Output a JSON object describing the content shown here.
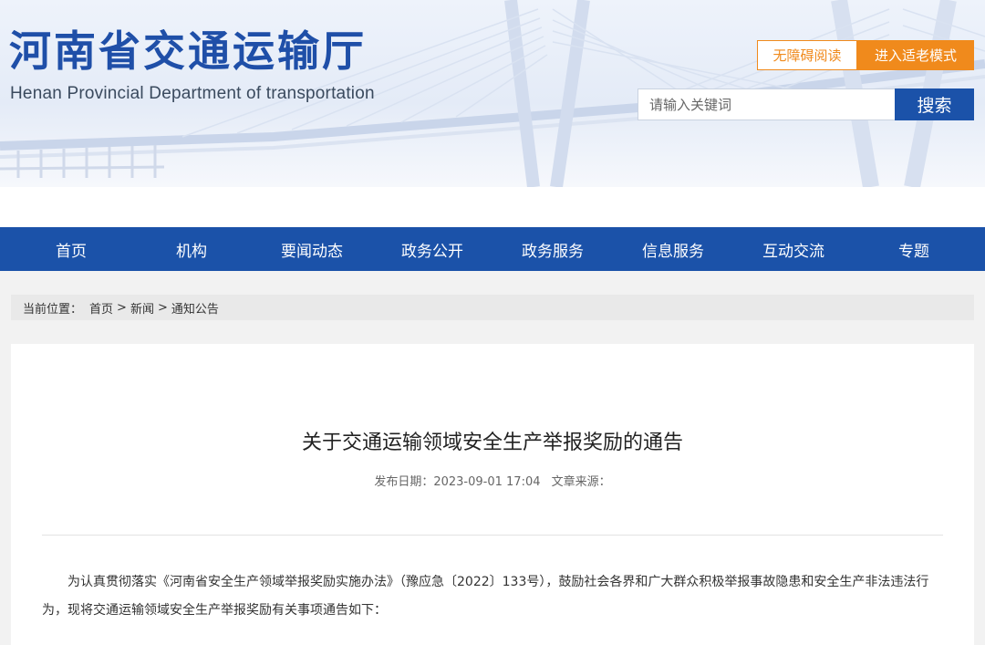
{
  "header": {
    "site_title": "河南省交通运输厅",
    "site_subtitle": "Henan Provincial Department of transportation",
    "accessible_label": "无障碍阅读",
    "elder_mode_label": "进入适老模式",
    "search": {
      "placeholder": "请输入关键词",
      "button_label": "搜索"
    }
  },
  "nav": {
    "items": [
      {
        "label": "首页"
      },
      {
        "label": "机构"
      },
      {
        "label": "要闻动态"
      },
      {
        "label": "政务公开"
      },
      {
        "label": "政务服务"
      },
      {
        "label": "信息服务"
      },
      {
        "label": "互动交流"
      },
      {
        "label": "专题"
      }
    ]
  },
  "breadcrumb": {
    "label": "当前位置：",
    "items": [
      "首页",
      "新闻",
      "通知公告"
    ],
    "separator": ">"
  },
  "article": {
    "title": "关于交通运输领域安全生产举报奖励的通告",
    "publish_date": "发布日期：2023-09-01 17:04",
    "source": "文章来源：",
    "paragraph_1": "为认真贯彻落实《河南省安全生产领域举报奖励实施办法》（豫应急〔2022〕133号），鼓励社会各界和广大群众积极举报事故隐患和安全生产非法违法行为，现将交通运输领域安全生产举报奖励有关事项通告如下："
  },
  "colors": {
    "brand_blue": "#1b52a9",
    "accent_orange": "#f08a1c",
    "title_blue": "#1f4fa8"
  }
}
